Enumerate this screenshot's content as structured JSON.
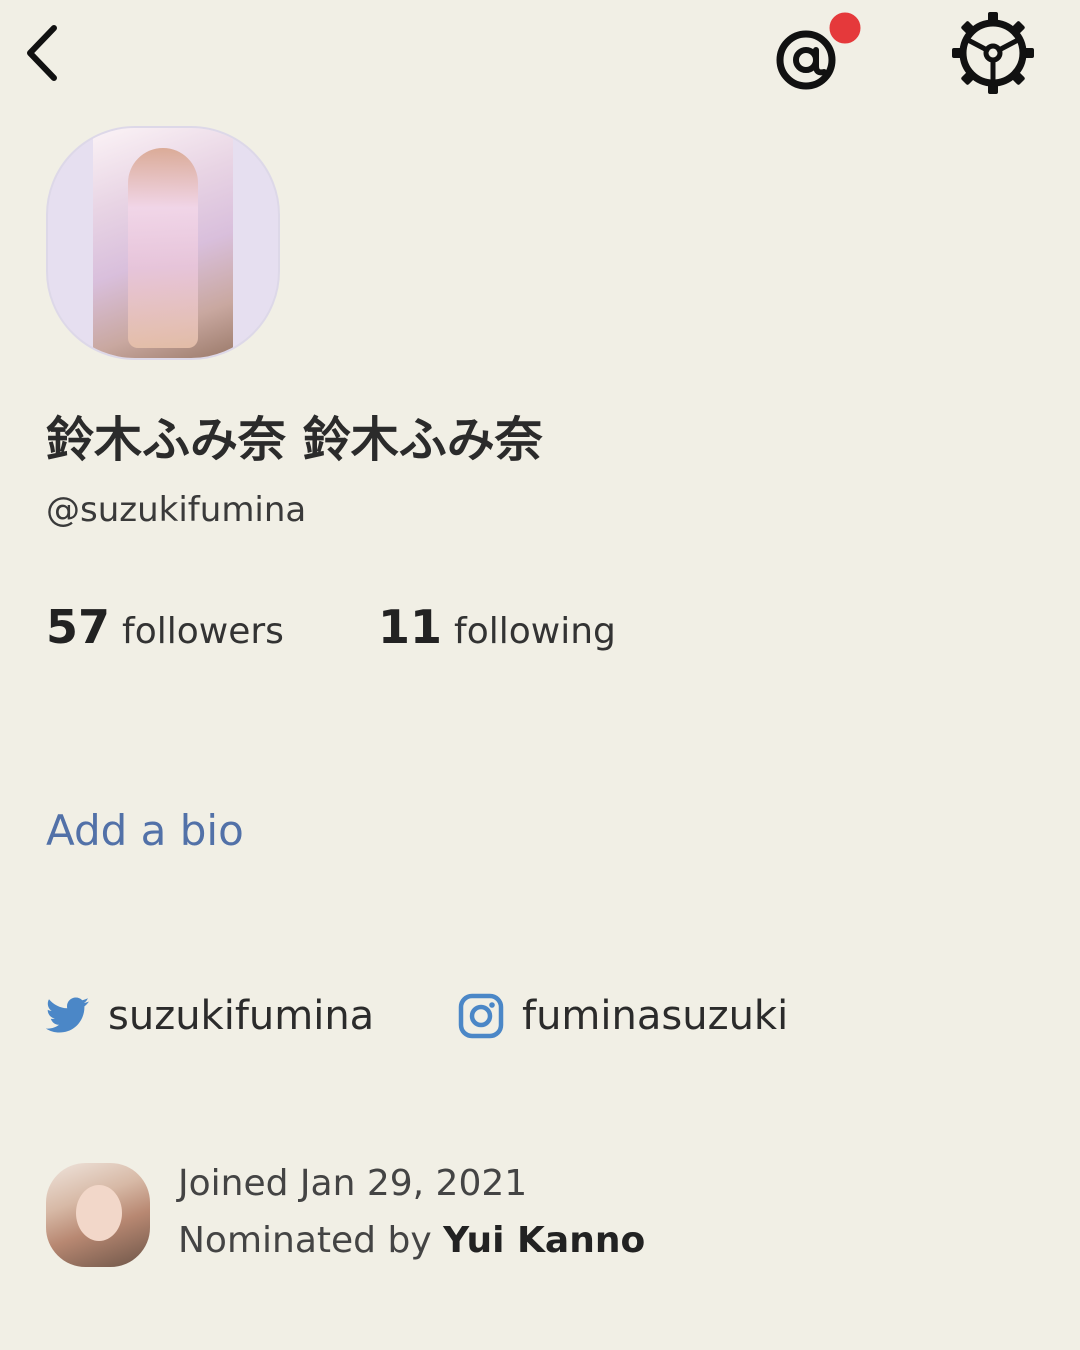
{
  "header": {
    "back_icon": "chevron-left-icon",
    "mention_icon": "at-sign-icon",
    "notification_dot_color": "#e5393b",
    "settings_icon": "gear-icon"
  },
  "profile": {
    "avatar_alt": "profile photo",
    "name": "鈴木ふみ奈 鈴木ふみ奈",
    "handle": "@suzukifumina",
    "followers_count": "57",
    "followers_label": "followers",
    "following_count": "11",
    "following_label": "following",
    "bio_prompt": "Add a bio"
  },
  "social": {
    "twitter_icon": "twitter-bird-icon",
    "twitter_handle": "suzukifumina",
    "twitter_color": "#4b87c7",
    "instagram_icon": "instagram-icon",
    "instagram_handle": "fuminasuzuki",
    "instagram_color": "#4b87c7"
  },
  "meta": {
    "joined": "Joined Jan 29, 2021",
    "nominated_prefix": "Nominated by ",
    "nominator": "Yui Kanno"
  },
  "colors": {
    "background": "#f1efe5",
    "link": "#5271a8"
  }
}
